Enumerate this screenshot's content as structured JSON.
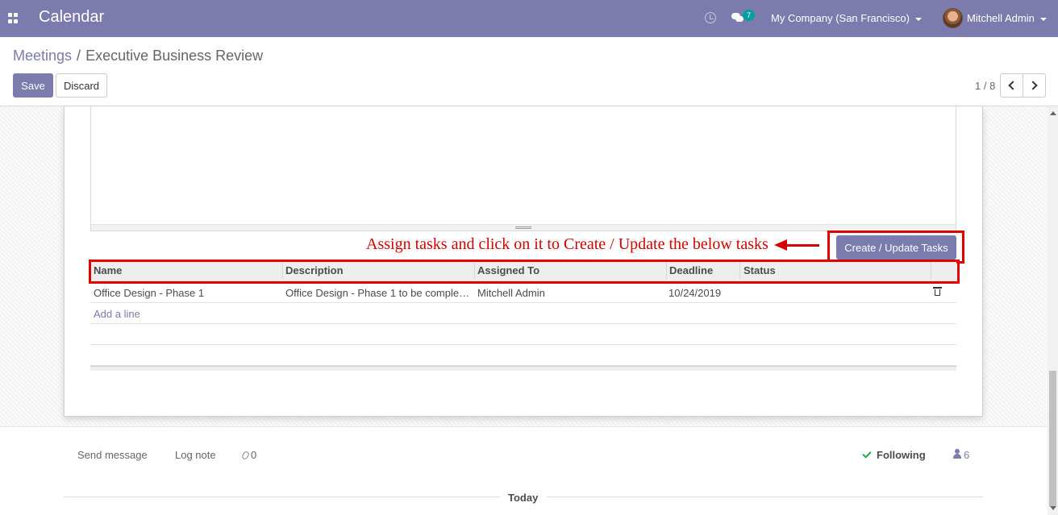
{
  "app": {
    "title": "Calendar"
  },
  "navbar": {
    "chat_badge": "7",
    "company": "My Company (San Francisco)",
    "user": "Mitchell Admin"
  },
  "breadcrumb": {
    "parent": "Meetings",
    "separator": "/",
    "current": "Executive Business Review"
  },
  "buttons": {
    "save": "Save",
    "discard": "Discard",
    "create_update": "Create / Update Tasks"
  },
  "pager": {
    "value": "1 / 8"
  },
  "annotation": {
    "text": "Assign tasks and click on it to Create / Update the below tasks"
  },
  "table": {
    "columns": [
      "Name",
      "Description",
      "Assigned To",
      "Deadline",
      "Status"
    ],
    "rows": [
      {
        "name": "Office Design - Phase 1",
        "description": "Office Design - Phase 1 to be comple…",
        "assigned_to": "Mitchell Admin",
        "deadline": "10/24/2019",
        "status": ""
      }
    ],
    "add_line": "Add a line"
  },
  "chatter": {
    "send_message": "Send message",
    "log_note": "Log note",
    "attachments_count": "0",
    "following": "Following",
    "followers_count": "6",
    "today": "Today"
  },
  "colors": {
    "brand": "#7c7bad",
    "annotation": "#d40000",
    "badge": "#00a09d",
    "following_check": "#28a745"
  }
}
